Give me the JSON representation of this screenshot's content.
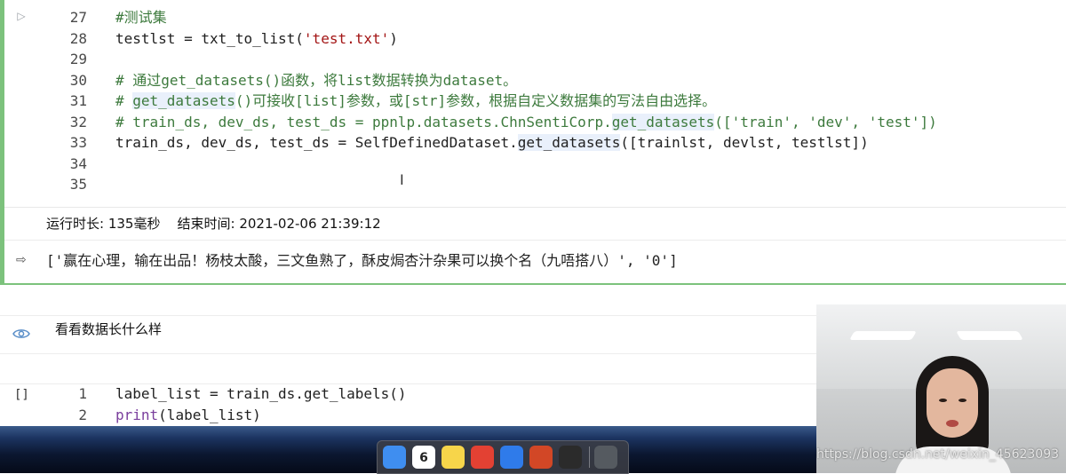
{
  "cell1": {
    "lines": [
      {
        "n": "27",
        "parts": [
          {
            "t": "#测试集",
            "c": "cmt"
          }
        ]
      },
      {
        "n": "28",
        "parts": [
          {
            "t": "testlst = txt_to_list(",
            "c": ""
          },
          {
            "t": "'test.txt'",
            "c": "str"
          },
          {
            "t": ")",
            "c": ""
          }
        ]
      },
      {
        "n": "29",
        "parts": []
      },
      {
        "n": "30",
        "parts": [
          {
            "t": "# 通过get_datasets()函数，将list数据转换为dataset。",
            "c": "cmt"
          }
        ]
      },
      {
        "n": "31",
        "parts": [
          {
            "t": "# ",
            "c": "cmt"
          },
          {
            "t": "get_datasets",
            "c": "cmt hl"
          },
          {
            "t": "()可接收[list]参数，或[str]参数，根据自定义数据集的写法自由选择。",
            "c": "cmt"
          }
        ]
      },
      {
        "n": "32",
        "parts": [
          {
            "t": "# train_ds, dev_ds, test_ds = ppnlp.datasets.ChnSentiCorp.",
            "c": "cmt"
          },
          {
            "t": "get_datasets",
            "c": "cmt hl"
          },
          {
            "t": "(['train', 'dev', 'test'])",
            "c": "cmt"
          }
        ]
      },
      {
        "n": "33",
        "parts": [
          {
            "t": "train_ds, dev_ds, test_ds = SelfDefinedDataset.",
            "c": ""
          },
          {
            "t": "get_datasets",
            "c": "hl"
          },
          {
            "t": "([trainlst, devlst, testlst])",
            "c": ""
          }
        ]
      },
      {
        "n": "34",
        "parts": []
      },
      {
        "n": "35",
        "parts": []
      }
    ],
    "exec_info": "运行时长: 135毫秒    结束时间: 2021-02-06 21:39:12",
    "output": "['赢在心理，输在出品！杨枝太酸，三文鱼熟了，酥皮焗杏汁杂果可以换个名（九唔搭八）', '0']"
  },
  "cell2": {
    "text": "看看数据长什么样"
  },
  "cell3": {
    "prompt": "[]",
    "lines": [
      {
        "n": "1",
        "parts": [
          {
            "t": "label_list = train_ds.get_labels()",
            "c": ""
          }
        ]
      },
      {
        "n": "2",
        "parts": [
          {
            "t": "print",
            "c": "kw"
          },
          {
            "t": "(label_list)",
            "c": ""
          }
        ]
      }
    ]
  },
  "dock": {
    "items": [
      {
        "name": "finder-icon",
        "color": "#3f8ef0"
      },
      {
        "name": "calendar-icon",
        "color": "#ffffff",
        "label": "6"
      },
      {
        "name": "notes-icon",
        "color": "#f7d54a"
      },
      {
        "name": "chrome-icon",
        "color": "#e34133"
      },
      {
        "name": "chat-app-icon",
        "color": "#2f7bea"
      },
      {
        "name": "powerpoint-icon",
        "color": "#d24726"
      },
      {
        "name": "obs-icon",
        "color": "#2b2b2b"
      }
    ]
  },
  "watermark": "https://blog.csdn.net/weixin_45623093"
}
